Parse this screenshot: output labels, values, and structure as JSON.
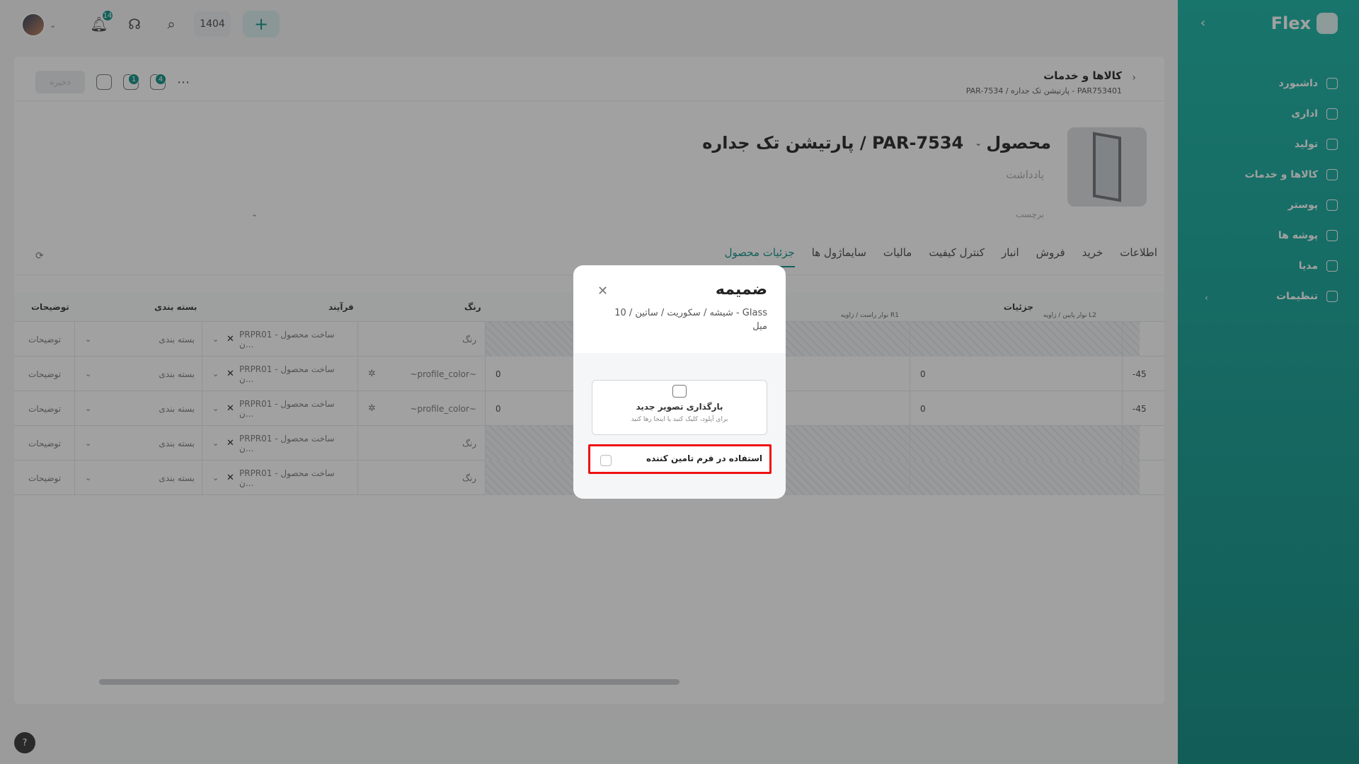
{
  "topbar": {
    "notification_count": "14",
    "year": "1404"
  },
  "sidebar": {
    "brand": "Flex",
    "items": [
      {
        "label": "داشبورد",
        "icon": "home-icon"
      },
      {
        "label": "اداری",
        "icon": "briefcase-icon"
      },
      {
        "label": "تولید",
        "icon": "production-icon"
      },
      {
        "label": "کالاها و خدمات",
        "icon": "products-icon"
      },
      {
        "label": "پوستر",
        "icon": "poster-icon"
      },
      {
        "label": "پوشه ها",
        "icon": "folder-icon"
      },
      {
        "label": "مدیا",
        "icon": "media-icon"
      },
      {
        "label": "تنظیمات",
        "icon": "settings-icon"
      }
    ]
  },
  "page": {
    "save_label": "ذخیره",
    "toolbar_badge_1": "1",
    "toolbar_badge_2": "4",
    "breadcrumb_title": "کالاها و خدمات",
    "breadcrumb_path": "PAR-7534 / پارتیشن تک جداره - PAR753401",
    "product_type": "محصول",
    "product_name": "PAR-7534 / پارتیشن تک جداره",
    "note_placeholder": "یادداشت",
    "tag_placeholder": "برچسب",
    "tabs": [
      "اطلاعات",
      "خرید",
      "فروش",
      "انبار",
      "کنترل کیفیت",
      "مالیات",
      "سایماژول ها",
      "جزئیات محصول"
    ],
    "active_tab": "جزئیات محصول"
  },
  "grid": {
    "headers": {
      "details": "جزئیات",
      "sub_l2": "نوار پایین / زاویه L2",
      "sub_r1": "نوار راست / زاویه R1",
      "color": "رنگ",
      "process": "فرآیند",
      "packaging": "بسته بندی",
      "description": "توضیحات"
    },
    "rows": [
      {
        "angle": "",
        "l2": "",
        "r1": "",
        "color": "رنگ",
        "process": "PRPR01 - ساخت محصول ن...",
        "packaging": "بسته بندی",
        "description": "توضیحات",
        "hatched": true
      },
      {
        "angle": "-45",
        "l2": "0",
        "r1": "0",
        "color": "~profile_color~",
        "process": "PRPR01 - ساخت محصول ن...",
        "packaging": "بسته بندی",
        "description": "توضیحات",
        "hatched": false
      },
      {
        "angle": "-45",
        "l2": "0",
        "r1": "0",
        "color": "~profile_color~",
        "process": "PRPR01 - ساخت محصول ن...",
        "packaging": "بسته بندی",
        "description": "توضیحات",
        "hatched": false
      },
      {
        "angle": "",
        "l2": "",
        "r1": "",
        "color": "رنگ",
        "process": "PRPR01 - ساخت محصول ن...",
        "packaging": "بسته بندی",
        "description": "توضیحات",
        "hatched": true
      },
      {
        "angle": "",
        "l2": "",
        "r1": "",
        "color": "رنگ",
        "process": "PRPR01 - ساخت محصول ن...",
        "packaging": "بسته بندی",
        "description": "توضیحات",
        "hatched": true
      }
    ]
  },
  "modal": {
    "title": "ضمیمه",
    "subtitle": "Glass - شیشه / سکوریت / ساتین / 10 میل",
    "upload_title": "بارگذاری تصویر جدید",
    "upload_hint": "برای آپلود، کلیک کنید یا اینجا رها کنید",
    "supplier_label": "استفاده در فرم تامین کننده"
  },
  "help_label": "?",
  "colors": {
    "accent": "#0b8f86",
    "highlight": "#e11111"
  }
}
